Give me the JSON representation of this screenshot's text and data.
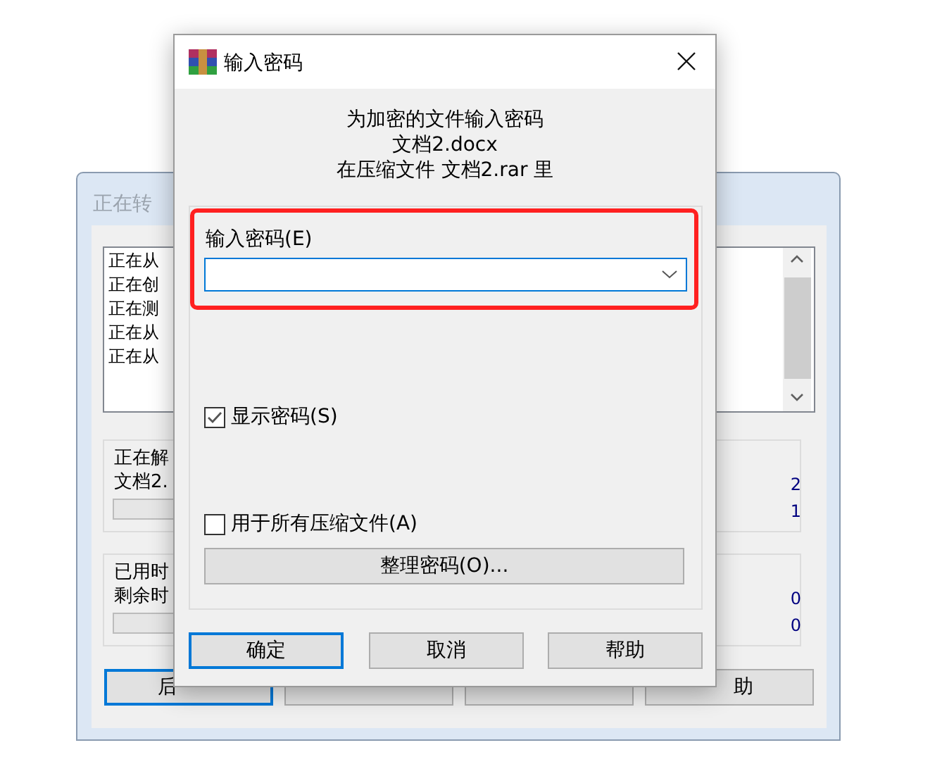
{
  "background_window": {
    "title": "正在转",
    "log_lines": [
      "正在从",
      "正在创",
      "正在测",
      "正在从",
      "正在从"
    ],
    "progress_group": {
      "label": "正在解",
      "file": "文档2.",
      "value_1": "2",
      "value_2": "1",
      "level": 0
    },
    "time_group": {
      "elapsed_label": "已用时",
      "remaining_label": "剩余时",
      "value_1": "0",
      "value_2": "0",
      "level": 0
    },
    "buttons": [
      {
        "label": "后",
        "selected": true
      },
      {
        "selected": false
      },
      {
        "selected": false
      },
      {
        "label": "助",
        "selected": false
      }
    ]
  },
  "dialog": {
    "title": "输入密码",
    "message": [
      "为加密的文件输入密码",
      "文档2.docx",
      "在压缩文件 文档2.rar 里"
    ],
    "password_label": "输入密码(E)",
    "highlighted": true,
    "checkboxes": [
      {
        "label": "显示密码(S)",
        "checked": true
      },
      {
        "label": "用于所有压缩文件(A)",
        "checked": false
      }
    ],
    "organize_button": "整理密码(O)...",
    "buttons": [
      {
        "label": "确定",
        "selected": true
      },
      {
        "label": "取消",
        "selected": false
      },
      {
        "label": "帮助",
        "selected": false
      }
    ]
  }
}
